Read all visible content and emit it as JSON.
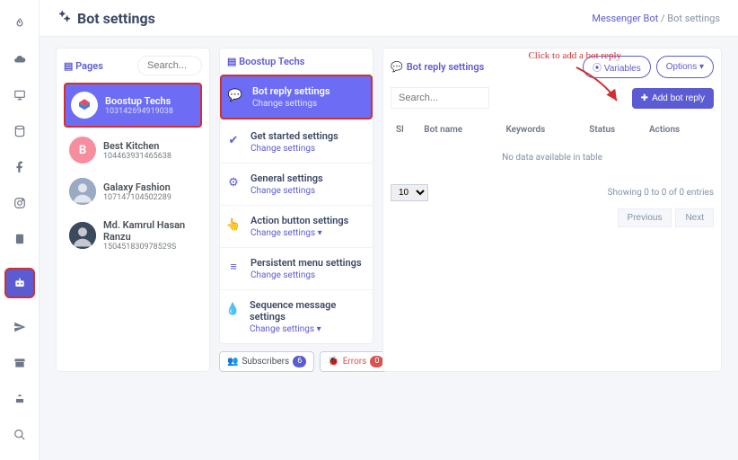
{
  "header": {
    "title": "Bot settings",
    "breadcrumb_link": "Messenger Bot",
    "breadcrumb_sep": " / ",
    "breadcrumb_current": "Bot settings"
  },
  "sidebar_icons": [
    "flame",
    "cloud-download",
    "monitor",
    "database",
    "facebook",
    "instagram",
    "contacts",
    "bot",
    "send",
    "store",
    "share",
    "search"
  ],
  "pages_panel": {
    "title": "Pages",
    "search_placeholder": "Search...",
    "items": [
      {
        "name": "Boostup Techs",
        "id": "103142694919038",
        "avatar_color": "#fff",
        "avatar_svg": true,
        "selected": true
      },
      {
        "name": "Best Kitchen",
        "id": "104463931465638",
        "avatar_color": "#f78ea0",
        "avatar_text": "B"
      },
      {
        "name": "Galaxy Fashion",
        "id": "107147104502289",
        "avatar_color": "#9aa9c4",
        "avatar_img": true
      },
      {
        "name": "Md. Kamrul Hasan Ranzu",
        "id": "150451830978529S",
        "avatar_color": "#3c4a5e",
        "avatar_img": true
      }
    ]
  },
  "settings_panel": {
    "title": "Boostup Techs",
    "items": [
      {
        "title": "Bot reply settings",
        "sub": "Change settings",
        "icon": "chat",
        "selected": true
      },
      {
        "title": "Get started settings",
        "sub": "Change settings",
        "icon": "check"
      },
      {
        "title": "General settings",
        "sub": "Change settings",
        "icon": "gear"
      },
      {
        "title": "Action button settings",
        "sub": "Change settings  ▾",
        "icon": "pointer"
      },
      {
        "title": "Persistent menu settings",
        "sub": "Change settings",
        "icon": "menu"
      },
      {
        "title": "Sequence message settings",
        "sub": "Change settings  ▾",
        "icon": "drop"
      }
    ],
    "subscribers_label": "Subscribers",
    "subscribers_count": "6",
    "errors_label": "Errors",
    "errors_count": "0"
  },
  "reply_panel": {
    "title": "Bot reply settings",
    "variables_btn": "Variables",
    "options_btn": "Options ▾",
    "add_btn": "Add bot reply",
    "search_placeholder": "Search...",
    "columns": [
      "Sl",
      "Bot name",
      "Keywords",
      "Status",
      "Actions"
    ],
    "empty_text": "No data available in table",
    "length_value": "10",
    "info_text": "Showing 0 to 0 of 0 entries",
    "prev": "Previous",
    "next": "Next"
  },
  "annotation": "Click to add a bot reply"
}
